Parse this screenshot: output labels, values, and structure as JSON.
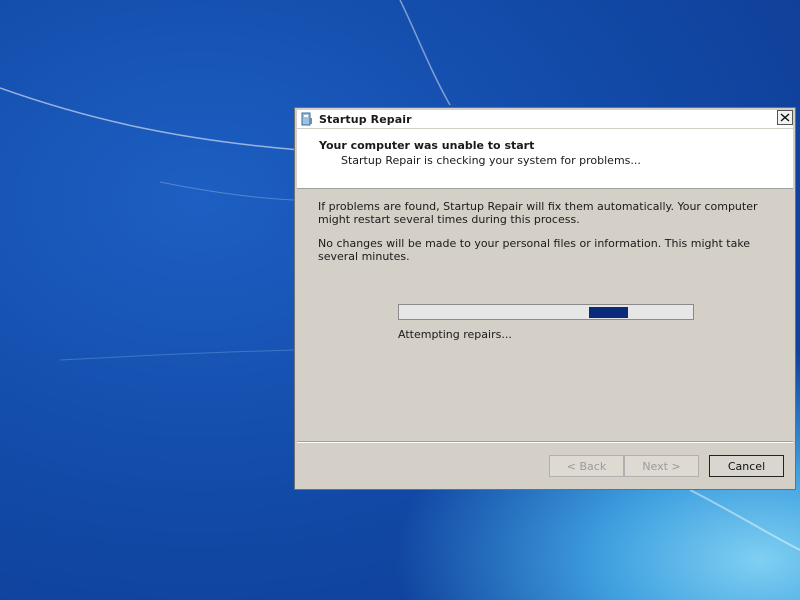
{
  "window": {
    "title": "Startup Repair",
    "icon": "startup-repair-icon",
    "close_icon": "close-icon"
  },
  "header": {
    "title": "Your computer was unable to start",
    "subtitle": "Startup Repair is checking your system for problems..."
  },
  "body": {
    "paragraph1": "If problems are found, Startup Repair will fix them automatically. Your computer might restart several times during this process.",
    "paragraph2": "No changes will be made to your personal files or information. This might take several minutes."
  },
  "progress": {
    "style": "marquee",
    "status": "Attempting repairs..."
  },
  "buttons": {
    "back": "< Back",
    "next": "Next >",
    "cancel": "Cancel"
  },
  "colors": {
    "progress_fill": "#0a2a7a",
    "dialog_bg": "#d4d0c8"
  }
}
